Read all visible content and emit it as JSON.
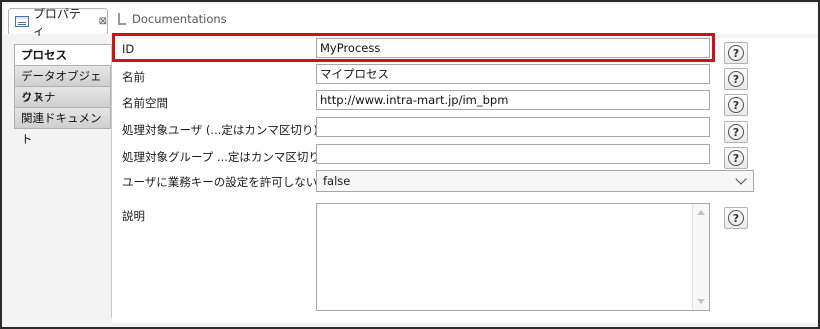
{
  "tabs": {
    "active": {
      "label": "プロパティ",
      "icon": "properties-icon",
      "close": "⊠"
    },
    "inactive": {
      "label": "Documentations",
      "icon": "document-icon"
    }
  },
  "sidebar": {
    "items": [
      {
        "label": "プロセス",
        "active": true
      },
      {
        "label": "データオブジェクト",
        "active": false
      },
      {
        "label": "リスナ",
        "active": false
      },
      {
        "label": "関連ドキュメント",
        "active": false
      }
    ]
  },
  "form": {
    "id": {
      "label": "ID",
      "value": "MyProcess"
    },
    "name": {
      "label": "名前",
      "value": "マイプロセス"
    },
    "namespace": {
      "label": "名前空間",
      "value": "http://www.intra-mart.jp/im_bpm"
    },
    "target_user": {
      "label": "処理対象ユーザ (...定はカンマ区切り)",
      "value": ""
    },
    "target_group": {
      "label": "処理対象グループ ...定はカンマ区切り)",
      "value": ""
    },
    "business_key": {
      "label": "ユーザに業務キーの設定を許可しない",
      "value": "false"
    },
    "description": {
      "label": "説明",
      "value": ""
    }
  },
  "help": {
    "glyph": "?"
  },
  "colors": {
    "highlight": "#cc1414"
  }
}
